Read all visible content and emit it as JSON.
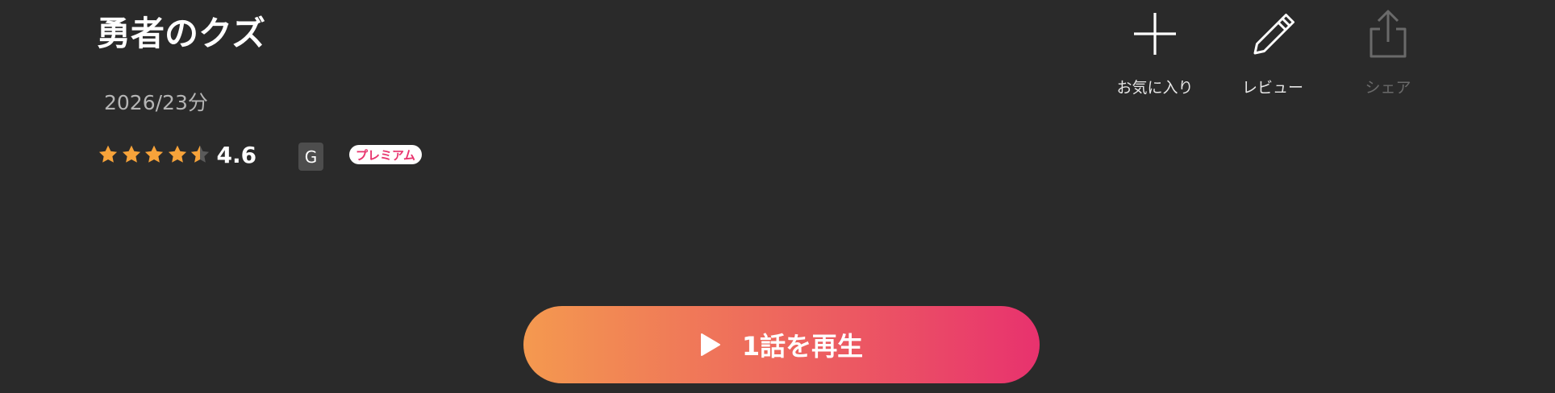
{
  "title": "勇者のクズ",
  "meta": "2026/23分",
  "rating": {
    "value": "4.6",
    "stars": 4.5,
    "star_icon": "star-icon"
  },
  "badges": {
    "age": "G",
    "premium": "プレミアム"
  },
  "actions": [
    {
      "label": "お気に入り",
      "icon": "plus-icon",
      "enabled": true
    },
    {
      "label": "レビュー",
      "icon": "pencil-icon",
      "enabled": true
    },
    {
      "label": "シェア",
      "icon": "share-icon",
      "enabled": false
    }
  ],
  "play_button": {
    "label": "1話を再生",
    "icon": "play-icon"
  },
  "colors": {
    "background": "#2a2a2a",
    "accent_start": "#f4994f",
    "accent_end": "#e8326e",
    "star": "#f7a33a"
  }
}
